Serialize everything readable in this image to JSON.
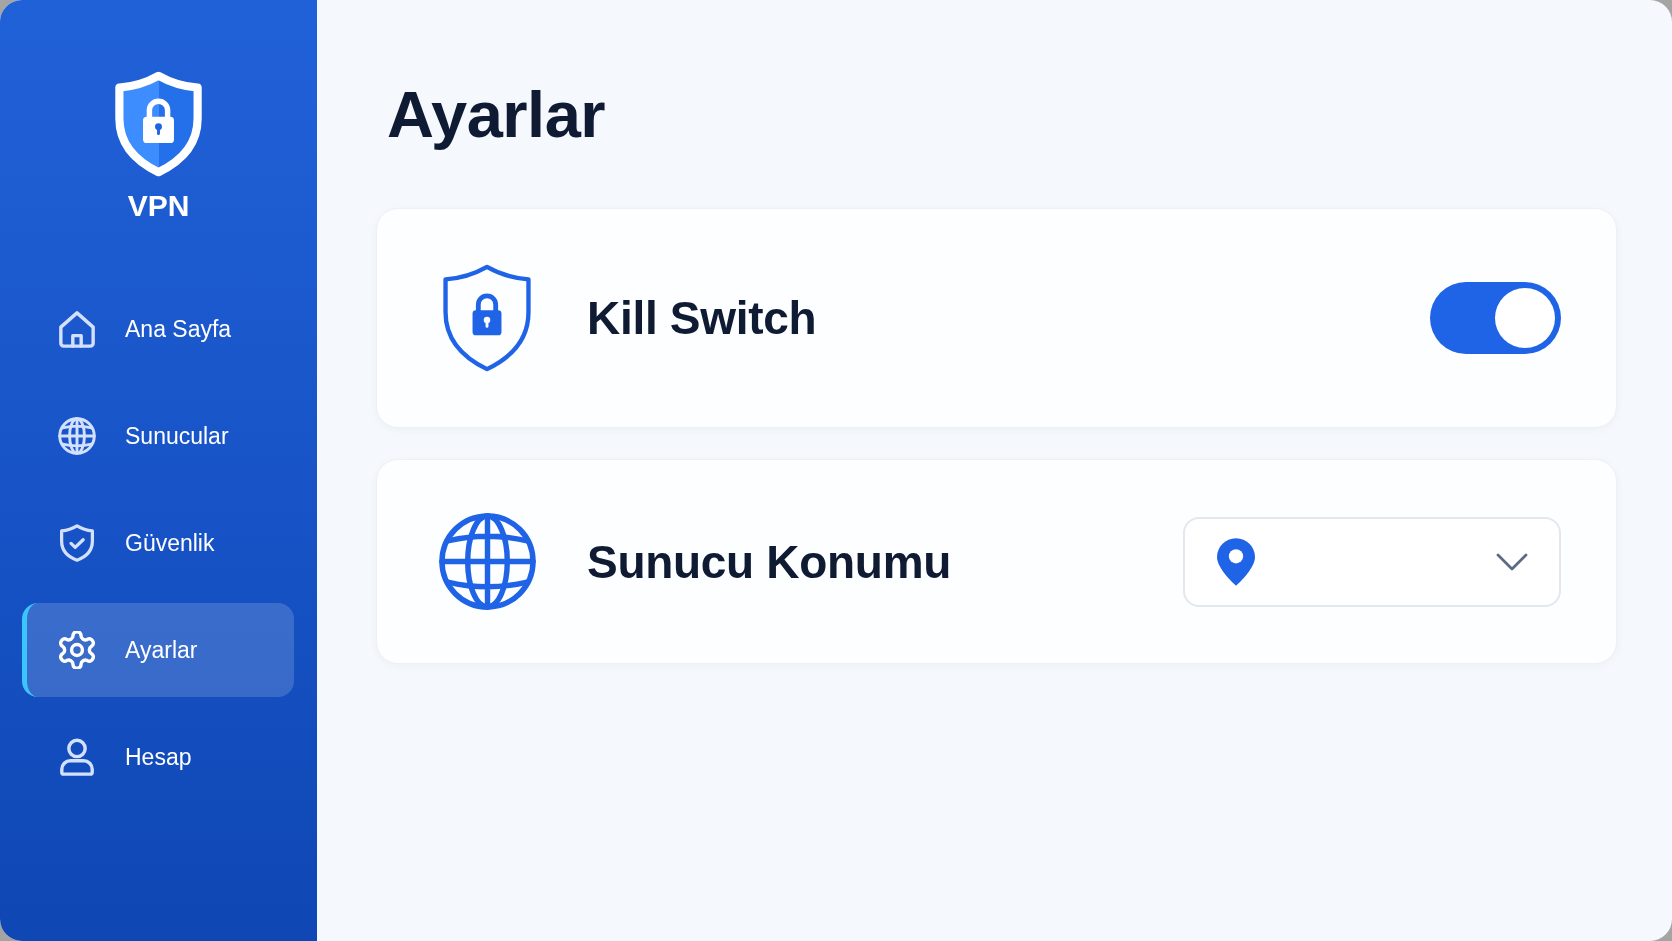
{
  "sidebar": {
    "logo_text": "VPN",
    "items": [
      {
        "label": "Ana Sayfa",
        "selected": false
      },
      {
        "label": "Sunucular",
        "selected": false
      },
      {
        "label": "Güvenlik",
        "selected": false
      },
      {
        "label": "Ayarlar",
        "selected": true
      },
      {
        "label": "Hesap",
        "selected": false
      }
    ]
  },
  "page_title": "Ayarlar",
  "settings": [
    {
      "kind": "toggle",
      "label": "Kill Switch",
      "on": true
    },
    {
      "kind": "select",
      "label": "Sunucu Konumu"
    }
  ]
}
